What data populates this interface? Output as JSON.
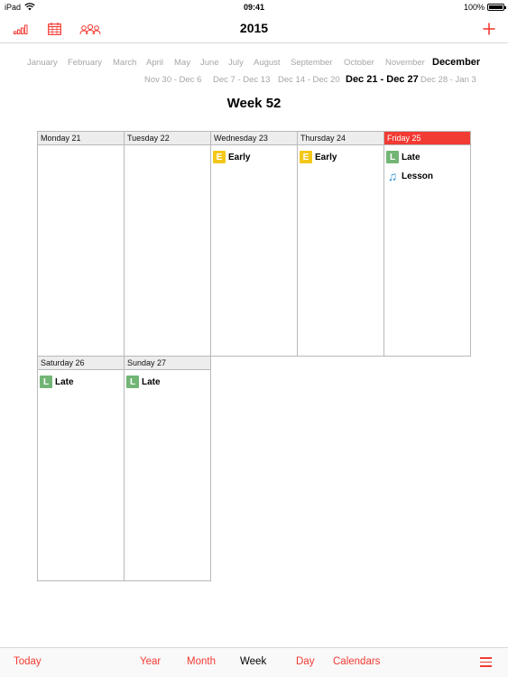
{
  "status_bar": {
    "device": "iPad",
    "time": "09:41",
    "battery": "100%"
  },
  "nav": {
    "title": "2015"
  },
  "months": [
    "January",
    "February",
    "March",
    "April",
    "May",
    "June",
    "July",
    "August",
    "September",
    "October",
    "November",
    "December"
  ],
  "current_month": "December",
  "weeks": [
    "Nov 30 - Dec 6",
    "Dec 7 - Dec 13",
    "Dec 14 - Dec 20",
    "Dec 21 - Dec 27",
    "Dec 28 - Jan 3"
  ],
  "current_week": "Dec 21 - Dec 27",
  "week_title": "Week 52",
  "days": [
    {
      "label": "Monday 21",
      "today": false,
      "events": []
    },
    {
      "label": "Tuesday 22",
      "today": false,
      "events": []
    },
    {
      "label": "Wednesday 23",
      "today": false,
      "events": [
        {
          "badge": "E",
          "type": "early",
          "label": "Early"
        }
      ]
    },
    {
      "label": "Thursday 24",
      "today": false,
      "events": [
        {
          "badge": "E",
          "type": "early",
          "label": "Early"
        }
      ]
    },
    {
      "label": "Friday 25",
      "today": true,
      "events": [
        {
          "badge": "L",
          "type": "late",
          "label": "Late"
        },
        {
          "badge": "♫",
          "type": "lesson",
          "label": "Lesson"
        }
      ]
    },
    {
      "label": "Saturday 26",
      "today": false,
      "events": [
        {
          "badge": "L",
          "type": "late",
          "label": "Late"
        }
      ]
    },
    {
      "label": "Sunday 27",
      "today": false,
      "events": [
        {
          "badge": "L",
          "type": "late",
          "label": "Late"
        }
      ]
    }
  ],
  "tabs": [
    {
      "label": "Today",
      "active": false
    },
    {
      "label": "Year",
      "active": false
    },
    {
      "label": "Month",
      "active": false
    },
    {
      "label": "Week",
      "active": true
    },
    {
      "label": "Day",
      "active": false
    },
    {
      "label": "Calendars",
      "active": false
    }
  ],
  "icons": {
    "stats": "bar-chart-icon",
    "calendar": "calendar-grid-icon",
    "people": "people-icon",
    "add": "plus-icon",
    "menu": "hamburger-menu-icon"
  },
  "colors": {
    "accent": "#f23b33",
    "early": "#f3c81b",
    "late": "#72b575",
    "lesson": "#2b8fd6"
  }
}
